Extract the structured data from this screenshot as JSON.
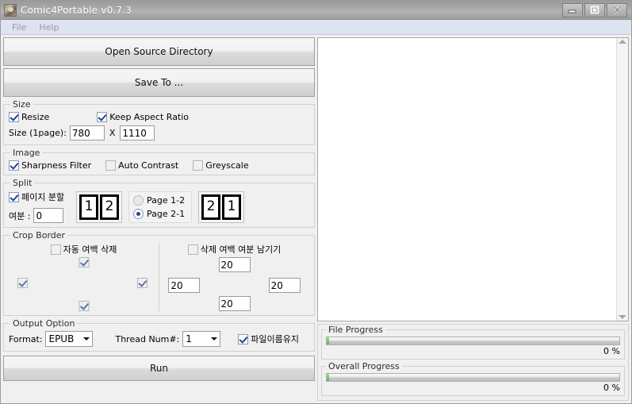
{
  "window": {
    "title": "Comic4Portable v0.7.3",
    "icon": "app-portrait-icon",
    "controls": {
      "minimize": "minimize-icon",
      "restore": "restore-icon",
      "close": "close-icon"
    }
  },
  "menubar": {
    "items": [
      {
        "label": "File"
      },
      {
        "label": "Help"
      }
    ]
  },
  "toolbar": {
    "open_source_label": "Open Source Directory",
    "save_to_label": "Save To ..."
  },
  "size_group": {
    "legend": "Size",
    "resize_label": "Resize",
    "resize_checked": true,
    "keep_aspect_label": "Keep Aspect Ratio",
    "keep_aspect_checked": true,
    "size_label": "Size (1page):",
    "width_value": "780",
    "x_label": "X",
    "height_value": "1110"
  },
  "image_group": {
    "legend": "Image",
    "sharpness_label": "Sharpness Filter",
    "sharpness_checked": true,
    "auto_contrast_label": "Auto Contrast",
    "auto_contrast_checked": false,
    "greyscale_label": "Greyscale",
    "greyscale_checked": false
  },
  "split_group": {
    "legend": "Split",
    "split_pages_label": "페이지 분할",
    "split_pages_checked": true,
    "margin_label": "여분 :",
    "margin_value": "0",
    "preview_left": {
      "first": "1",
      "second": "2"
    },
    "preview_right": {
      "first": "2",
      "second": "1"
    },
    "order_options": [
      {
        "label": "Page 1-2",
        "selected": false
      },
      {
        "label": "Page 2-1",
        "selected": true
      }
    ]
  },
  "crop_group": {
    "legend": "Crop Border",
    "auto_crop_label": "자동 여백 삭제",
    "auto_crop_checked": false,
    "sides": [
      {
        "name": "top",
        "checked": true
      },
      {
        "name": "left",
        "checked": true
      },
      {
        "name": "right",
        "checked": true
      },
      {
        "name": "bottom",
        "checked": true
      }
    ],
    "keep_margin_label": "삭제 여백 여분 남기기",
    "keep_margin_checked": false,
    "margins": [
      {
        "name": "top",
        "value": "20"
      },
      {
        "name": "left",
        "value": "20"
      },
      {
        "name": "right",
        "value": "20"
      },
      {
        "name": "bottom",
        "value": "20"
      }
    ]
  },
  "output_group": {
    "legend": "Output Option",
    "format_label": "Format:",
    "format_value": "EPUB",
    "thread_label": "Thread Num#:",
    "thread_value": "1",
    "keep_filename_label": "파일이름유지",
    "keep_filename_checked": true
  },
  "run_button_label": "Run",
  "file_list": {
    "items": []
  },
  "progress": {
    "file": {
      "legend": "File Progress",
      "percent_label": "0 %",
      "value": 0
    },
    "overall": {
      "legend": "Overall Progress",
      "percent_label": "0 %",
      "value": 0
    }
  },
  "colors": {
    "accent_blue": "#21439c",
    "progress_green": "#4cbb4c",
    "window_bg": "#f0f0f0",
    "menubar_bg": "#dde3f0",
    "titlebar": "#a8a8a8"
  }
}
